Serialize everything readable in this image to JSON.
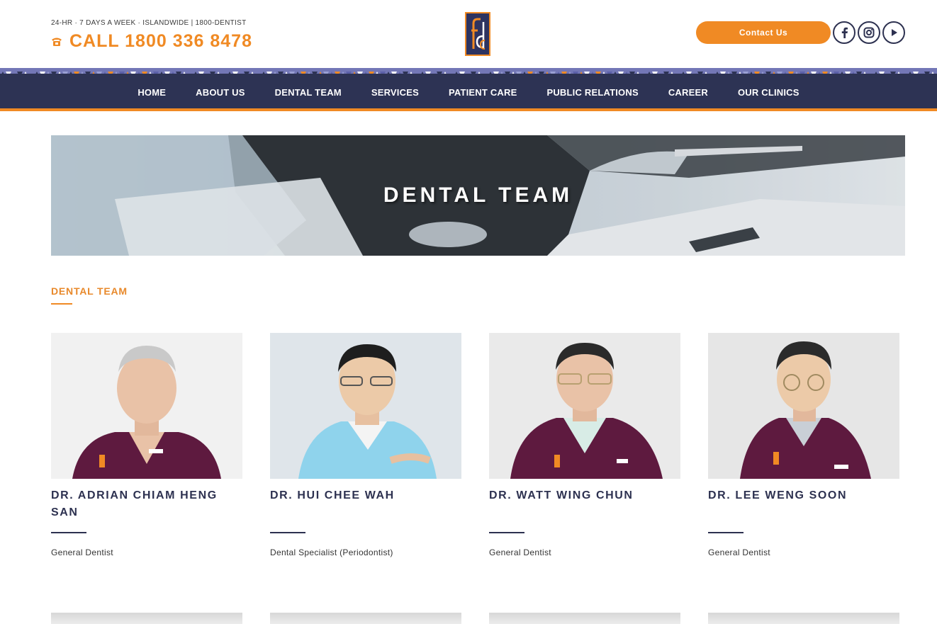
{
  "header": {
    "tagline": "24-HR · 7 DAYS A WEEK · ISLANDWIDE | 1800-DENTIST",
    "call_label": "CALL 1800 336 8478",
    "contact_button": "Contact Us",
    "icons": [
      "phone-icon",
      "facebook-icon",
      "instagram-icon",
      "youtube-icon"
    ]
  },
  "nav": {
    "items": [
      "HOME",
      "ABOUT US",
      "DENTAL TEAM",
      "SERVICES",
      "PATIENT CARE",
      "PUBLIC RELATIONS",
      "CAREER",
      "OUR CLINICS"
    ]
  },
  "banner": {
    "title": "DENTAL TEAM"
  },
  "section": {
    "heading": "DENTAL TEAM"
  },
  "team": [
    {
      "name": "DR. ADRIAN CHIAM HENG SAN",
      "role": "General Dentist"
    },
    {
      "name": "DR. HUI CHEE WAH",
      "role": "Dental Specialist (Periodontist)"
    },
    {
      "name": "DR. WATT WING CHUN",
      "role": "General Dentist"
    },
    {
      "name": "DR. LEE WENG SOON",
      "role": "General Dentist"
    }
  ],
  "colors": {
    "accent": "#f08a24",
    "navy": "#2d3354",
    "scrub": "#5e1a3f",
    "gown": "#8fd3ec"
  }
}
